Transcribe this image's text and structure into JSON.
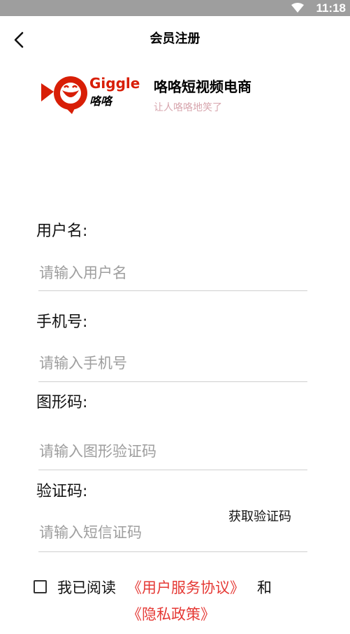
{
  "status_bar": {
    "time": "11:18",
    "wifi_icon": "wifi-icon"
  },
  "header": {
    "back_icon": "chevron-left-icon",
    "title": "会员注册"
  },
  "brand": {
    "logo_text": "Giggle",
    "logo_cn": "咯咯",
    "name": "咯咯短视频电商",
    "slogan": "让人咯咯地笑了",
    "logo_color": "#d81e06"
  },
  "form": {
    "username": {
      "label": "用户名:",
      "placeholder": "请输入用户名",
      "value": ""
    },
    "phone": {
      "label": "手机号:",
      "placeholder": "请输入手机号",
      "value": ""
    },
    "captcha": {
      "label": "图形码:",
      "placeholder": "请输入图形验证码",
      "value": ""
    },
    "sms_code": {
      "label": "验证码:",
      "placeholder": "请输入短信证码",
      "value": "",
      "get_code_label": "获取验证码"
    }
  },
  "agreement": {
    "checked": false,
    "prefix": "我已阅读",
    "terms_link": "《用户服务协议》",
    "conjunction": "和",
    "privacy_link": "《隐私政策》",
    "link_color": "#e53935"
  }
}
